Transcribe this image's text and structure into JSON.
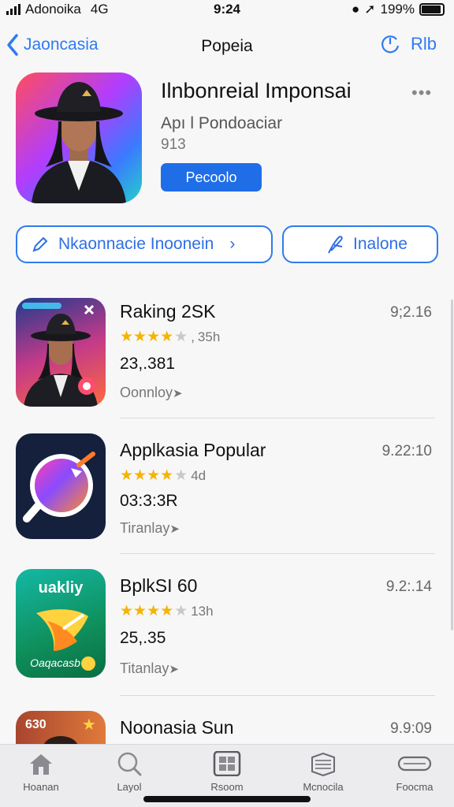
{
  "status": {
    "carrier": "Adonoika",
    "network": "4G",
    "time": "9:24",
    "battery": "199%"
  },
  "nav": {
    "back_label": "Jaoncasia",
    "title": "Popeia",
    "right_label": "Rlb"
  },
  "featured": {
    "name": "Ilnbonreial Imponsai",
    "subtitle": "Apı l Pondoaciar",
    "number": "913",
    "button_label": "Pecoolo",
    "more": "•••"
  },
  "chips": [
    {
      "label": "Nkaonnacie Inoonein",
      "chevron": "›"
    },
    {
      "label": "Inalone"
    }
  ],
  "apps": [
    {
      "name": "Raking 2SK",
      "rating_count": "35h",
      "size": "23,.381",
      "tag": "Oonnloy",
      "version": "9;2.16"
    },
    {
      "name": "Applkasia Popular",
      "rating_count": "4d",
      "size": "03:3:3R",
      "tag": "Tiranlay",
      "version": "9.22:10"
    },
    {
      "name": "BplkSI 60",
      "rating_count": "13h",
      "size": "25,.35",
      "tag": "Titanlay",
      "version": "9.2:.14"
    },
    {
      "name": "Noonasia Sun",
      "version": "9.9:09"
    }
  ],
  "tabs": [
    {
      "label": "Hoanan",
      "icon": "home-icon"
    },
    {
      "label": "Layol",
      "icon": "search-icon"
    },
    {
      "label": "Rsoom",
      "icon": "grid-icon"
    },
    {
      "label": "Mcnocila",
      "icon": "stack-icon"
    },
    {
      "label": "Foocma",
      "icon": "card-icon"
    }
  ],
  "colors": {
    "accent": "#2f7cf0",
    "star": "#f5b400",
    "button": "#1f6ee8"
  }
}
